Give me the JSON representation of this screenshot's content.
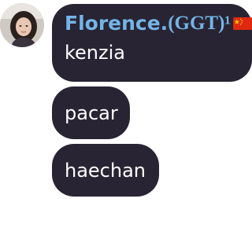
{
  "sender": {
    "name": "Florence.",
    "tag": "(GGT)¹",
    "flag_icon": "china-flag-icon",
    "name_color": "#74b4e6"
  },
  "messages": [
    {
      "text": "kenzia"
    },
    {
      "text": "pacar"
    },
    {
      "text": "haechan"
    }
  ],
  "colors": {
    "bubble": "#282433",
    "text": "#ffffff",
    "background": "#ffffff"
  }
}
